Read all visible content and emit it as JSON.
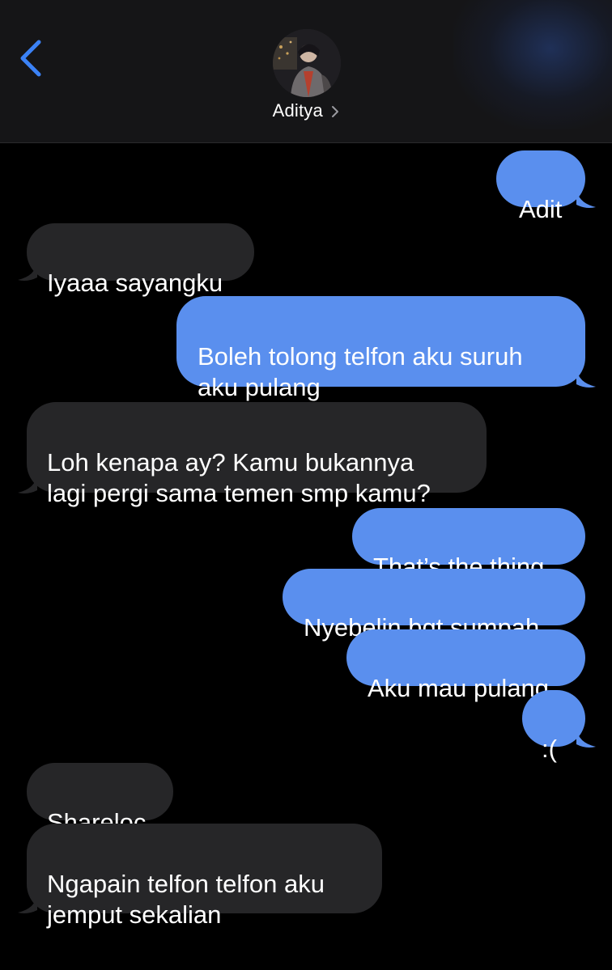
{
  "header": {
    "contact_name": "Aditya"
  },
  "messages": [
    {
      "dir": "sent",
      "text": "Adit"
    },
    {
      "dir": "received",
      "text": "Iyaaa sayangku"
    },
    {
      "dir": "sent",
      "text": "Boleh tolong telfon aku suruh\naku pulang"
    },
    {
      "dir": "received",
      "text": "Loh kenapa ay? Kamu bukannya\nlagi pergi sama temen smp kamu?"
    },
    {
      "dir": "sent",
      "text": "That’s the thing"
    },
    {
      "dir": "sent",
      "text": "Nyebelin bgt sumpah"
    },
    {
      "dir": "sent",
      "text": "Aku mau pulang"
    },
    {
      "dir": "sent",
      "text": ":("
    },
    {
      "dir": "received",
      "text": "Shareloc"
    },
    {
      "dir": "received",
      "text": "Ngapain telfon telfon aku\njemput sekalian"
    }
  ],
  "colors": {
    "sent_bubble": "#5a8fee",
    "received_bubble": "#262628",
    "accent": "#3b82f6"
  }
}
